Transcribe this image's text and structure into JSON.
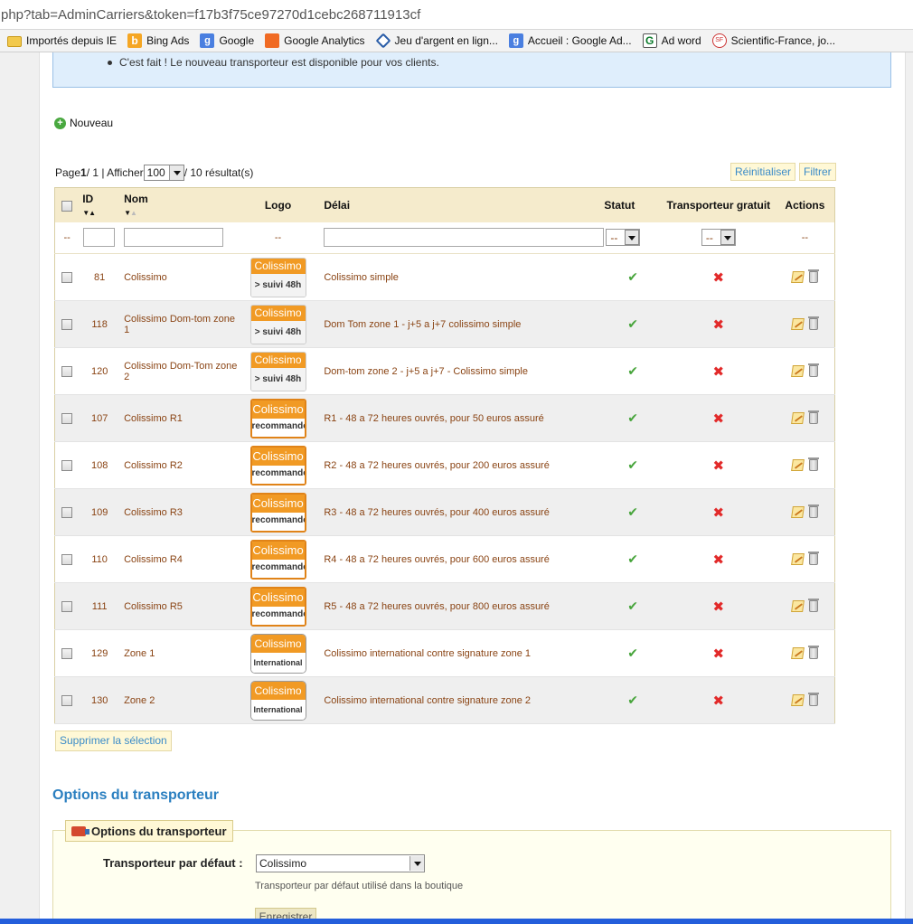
{
  "browser": {
    "url": "php?tab=AdminCarriers&token=f17b3f75ce97270d1cebc268711913cf",
    "bookmarks": [
      {
        "label": "Importés depuis IE",
        "icon": "folder-icon"
      },
      {
        "label": "Bing Ads",
        "icon": "bing-icon"
      },
      {
        "label": "Google",
        "icon": "google-icon"
      },
      {
        "label": "Google Analytics",
        "icon": "analytics-icon"
      },
      {
        "label": "Jeu d'argent en lign...",
        "icon": "diamond-icon"
      },
      {
        "label": "Accueil : Google Ad...",
        "icon": "google-icon"
      },
      {
        "label": "Ad word",
        "icon": "adwords-icon"
      },
      {
        "label": "Scientific-France, jo...",
        "icon": "scientific-france-icon"
      }
    ]
  },
  "confirmation": "C'est fait ! Le nouveau transporteur est disponible pour vos clients.",
  "new_label": "Nouveau",
  "pager": {
    "page_prefix": "Page ",
    "page_current": "1",
    "page_total": " / 1 | Afficher ",
    "per_page": "100",
    "results": " / 10 résultat(s)"
  },
  "buttons": {
    "reset": "Réinitialiser",
    "filter": "Filtrer",
    "delete_selection": "Supprimer la sélection",
    "save": "Enregistrer"
  },
  "table": {
    "headers": {
      "id": "ID",
      "name": "Nom",
      "logo": "Logo",
      "delay": "Délai",
      "status": "Statut",
      "free": "Transporteur gratuit",
      "actions": "Actions"
    },
    "filter_placeholder": "--",
    "filter_select": "--",
    "rows": [
      {
        "id": "81",
        "name": "Colissimo",
        "delay": "Colissimo simple",
        "logo": "suivi",
        "status": "✔",
        "free": "✖"
      },
      {
        "id": "118",
        "name": "Colissimo Dom-tom zone 1",
        "delay": "Dom Tom zone 1 - j+5 a j+7 colissimo simple",
        "logo": "suivi",
        "status": "✔",
        "free": "✖"
      },
      {
        "id": "120",
        "name": "Colissimo Dom-Tom zone 2",
        "delay": "Dom-tom zone 2 - j+5 a j+7 - Colissimo simple",
        "logo": "suivi",
        "status": "✔",
        "free": "✖"
      },
      {
        "id": "107",
        "name": "Colissimo R1",
        "delay": "R1 - 48 a 72 heures ouvrés, pour 50 euros assuré",
        "logo": "recommande",
        "status": "✔",
        "free": "✖"
      },
      {
        "id": "108",
        "name": "Colissimo R2",
        "delay": "R2 - 48 a 72 heures ouvrés, pour 200 euros assuré",
        "logo": "recommande",
        "status": "✔",
        "free": "✖"
      },
      {
        "id": "109",
        "name": "Colissimo R3",
        "delay": "R3 - 48 a 72 heures ouvrés, pour 400 euros assuré",
        "logo": "recommande",
        "status": "✔",
        "free": "✖"
      },
      {
        "id": "110",
        "name": "Colissimo R4",
        "delay": "R4 - 48 a 72 heures ouvrés, pour 600 euros assuré",
        "logo": "recommande",
        "status": "✔",
        "free": "✖"
      },
      {
        "id": "111",
        "name": "Colissimo R5",
        "delay": "R5 - 48 a 72 heures ouvrés, pour 800 euros assuré",
        "logo": "recommande",
        "status": "✔",
        "free": "✖"
      },
      {
        "id": "129",
        "name": "Zone 1",
        "delay": "Colissimo international contre signature zone 1",
        "logo": "international",
        "status": "✔",
        "free": "✖"
      },
      {
        "id": "130",
        "name": "Zone 2",
        "delay": "Colissimo international contre signature zone 2",
        "logo": "international",
        "status": "✔",
        "free": "✖"
      }
    ],
    "logo_text": {
      "brand": "Colissimo",
      "suivi": "> suivi 48h",
      "recommande": "recommandé",
      "international": "International"
    }
  },
  "options": {
    "section_title": "Options du transporteur",
    "legend": "Options du transporteur",
    "default_label": "Transporteur par défaut :",
    "default_value": "Colissimo",
    "default_help": "Transporteur par défaut utilisé dans la boutique"
  },
  "colors": {
    "link": "#2a7fc0",
    "row_text": "#8a4414",
    "header_bg": "#f5ebcc",
    "ok": "#46a43a",
    "ko": "#e22a2a"
  }
}
